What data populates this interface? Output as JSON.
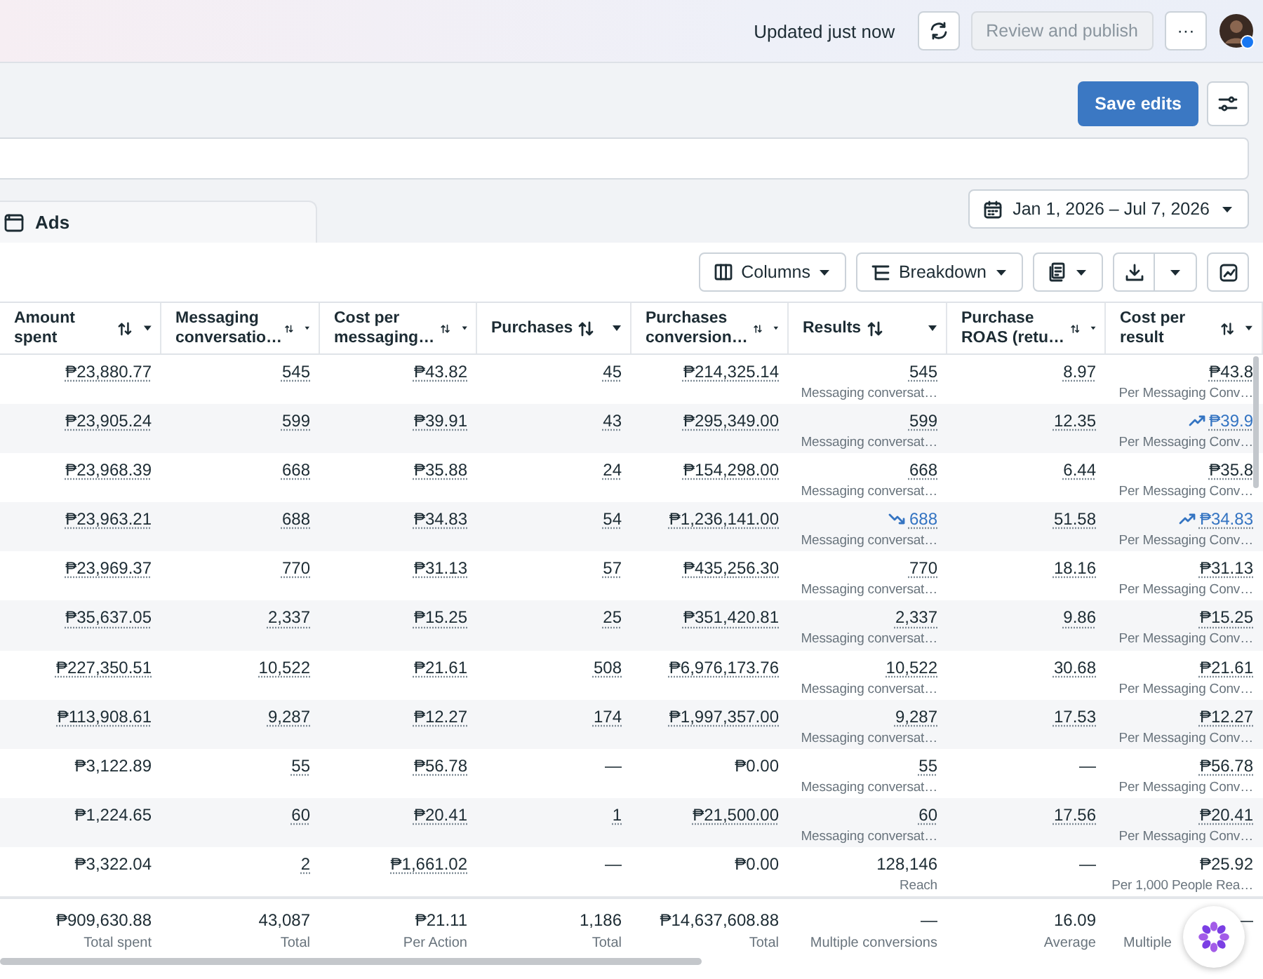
{
  "top_bar": {
    "status": "Updated just now",
    "review_button": {
      "label": "Review and publish",
      "disabled": true
    },
    "more_button": {
      "label": "···"
    }
  },
  "save_button": {
    "label": "Save edits"
  },
  "tab": {
    "label": "Ads"
  },
  "date_range": {
    "label": "Jan 1, 2026 – Jul 7, 2026"
  },
  "toolbar": {
    "columns": "Columns",
    "breakdown": "Breakdown"
  },
  "table": {
    "columns": [
      {
        "label": "Amount spent"
      },
      {
        "label": "Messaging conversatio…"
      },
      {
        "label": "Cost per messaging…"
      },
      {
        "label": "Purchases"
      },
      {
        "label": "Purchases conversion…"
      },
      {
        "label": "Results"
      },
      {
        "label": "Purchase ROAS (retu…"
      },
      {
        "label": "Cost per result"
      }
    ],
    "rows": [
      {
        "cells": [
          {
            "value": "₱23,880.77",
            "underlined": true
          },
          {
            "value": "545",
            "underlined": true
          },
          {
            "value": "₱43.82",
            "underlined": true
          },
          {
            "value": "45",
            "underlined": true
          },
          {
            "value": "₱214,325.14",
            "underlined": true
          },
          {
            "value": "545",
            "underlined": true,
            "sub": "Messaging conversat…"
          },
          {
            "value": "8.97",
            "underlined": true
          },
          {
            "value": "₱43.8",
            "underlined": true,
            "sub": "Per Messaging Conv…"
          }
        ]
      },
      {
        "cells": [
          {
            "value": "₱23,905.24",
            "underlined": true
          },
          {
            "value": "599",
            "underlined": true
          },
          {
            "value": "₱39.91",
            "underlined": true
          },
          {
            "value": "43",
            "underlined": true
          },
          {
            "value": "₱295,349.00",
            "underlined": true
          },
          {
            "value": "599",
            "underlined": true,
            "sub": "Messaging conversat…"
          },
          {
            "value": "12.35",
            "underlined": true
          },
          {
            "value": "₱39.9",
            "underlined": true,
            "trend_up": true,
            "sub": "Per Messaging Conv…"
          }
        ]
      },
      {
        "cells": [
          {
            "value": "₱23,968.39",
            "underlined": true
          },
          {
            "value": "668",
            "underlined": true
          },
          {
            "value": "₱35.88",
            "underlined": true
          },
          {
            "value": "24",
            "underlined": true
          },
          {
            "value": "₱154,298.00",
            "underlined": true
          },
          {
            "value": "668",
            "underlined": true,
            "sub": "Messaging conversat…"
          },
          {
            "value": "6.44",
            "underlined": true
          },
          {
            "value": "₱35.8",
            "underlined": true,
            "sub": "Per Messaging Conv…"
          }
        ]
      },
      {
        "cells": [
          {
            "value": "₱23,963.21",
            "underlined": true
          },
          {
            "value": "688",
            "underlined": true
          },
          {
            "value": "₱34.83",
            "underlined": true
          },
          {
            "value": "54",
            "underlined": true
          },
          {
            "value": "₱1,236,141.00",
            "underlined": true
          },
          {
            "value": "688",
            "underlined": true,
            "trend_down": true,
            "sub": "Messaging conversat…"
          },
          {
            "value": "51.58",
            "underlined": true
          },
          {
            "value": "₱34.83",
            "underlined": true,
            "trend_up": true,
            "sub": "Per Messaging Conv…"
          }
        ]
      },
      {
        "cells": [
          {
            "value": "₱23,969.37",
            "underlined": true
          },
          {
            "value": "770",
            "underlined": true
          },
          {
            "value": "₱31.13",
            "underlined": true
          },
          {
            "value": "57",
            "underlined": true
          },
          {
            "value": "₱435,256.30",
            "underlined": true
          },
          {
            "value": "770",
            "underlined": true,
            "sub": "Messaging conversat…"
          },
          {
            "value": "18.16",
            "underlined": true
          },
          {
            "value": "₱31.13",
            "underlined": true,
            "sub": "Per Messaging Conv…"
          }
        ]
      },
      {
        "cells": [
          {
            "value": "₱35,637.05",
            "underlined": true
          },
          {
            "value": "2,337",
            "underlined": true
          },
          {
            "value": "₱15.25",
            "underlined": true
          },
          {
            "value": "25",
            "underlined": true
          },
          {
            "value": "₱351,420.81",
            "underlined": true
          },
          {
            "value": "2,337",
            "underlined": true,
            "sub": "Messaging conversat…"
          },
          {
            "value": "9.86",
            "underlined": true
          },
          {
            "value": "₱15.25",
            "underlined": true,
            "sub": "Per Messaging Conv…"
          }
        ]
      },
      {
        "cells": [
          {
            "value": "₱227,350.51",
            "underlined": true
          },
          {
            "value": "10,522",
            "underlined": true
          },
          {
            "value": "₱21.61",
            "underlined": true
          },
          {
            "value": "508",
            "underlined": true
          },
          {
            "value": "₱6,976,173.76",
            "underlined": true
          },
          {
            "value": "10,522",
            "underlined": true,
            "sub": "Messaging conversat…"
          },
          {
            "value": "30.68",
            "underlined": true
          },
          {
            "value": "₱21.61",
            "underlined": true,
            "sub": "Per Messaging Conv…"
          }
        ]
      },
      {
        "cells": [
          {
            "value": "₱113,908.61",
            "underlined": true
          },
          {
            "value": "9,287",
            "underlined": true
          },
          {
            "value": "₱12.27",
            "underlined": true
          },
          {
            "value": "174",
            "underlined": true
          },
          {
            "value": "₱1,997,357.00",
            "underlined": true
          },
          {
            "value": "9,287",
            "underlined": true,
            "sub": "Messaging conversat…"
          },
          {
            "value": "17.53",
            "underlined": true
          },
          {
            "value": "₱12.27",
            "underlined": true,
            "sub": "Per Messaging Conv…"
          }
        ]
      },
      {
        "cells": [
          {
            "value": "₱3,122.89",
            "underlined": false
          },
          {
            "value": "55",
            "underlined": true
          },
          {
            "value": "₱56.78",
            "underlined": true
          },
          {
            "value": "—",
            "underlined": false
          },
          {
            "value": "₱0.00",
            "underlined": false
          },
          {
            "value": "55",
            "underlined": true,
            "sub": "Messaging conversat…"
          },
          {
            "value": "—",
            "underlined": false
          },
          {
            "value": "₱56.78",
            "underlined": true,
            "sub": "Per Messaging Conv…"
          }
        ]
      },
      {
        "cells": [
          {
            "value": "₱1,224.65",
            "underlined": false
          },
          {
            "value": "60",
            "underlined": true
          },
          {
            "value": "₱20.41",
            "underlined": true
          },
          {
            "value": "1",
            "underlined": true
          },
          {
            "value": "₱21,500.00",
            "underlined": true
          },
          {
            "value": "60",
            "underlined": true,
            "sub": "Messaging conversat…"
          },
          {
            "value": "17.56",
            "underlined": true
          },
          {
            "value": "₱20.41",
            "underlined": true,
            "sub": "Per Messaging Conv…"
          }
        ]
      },
      {
        "cells": [
          {
            "value": "₱3,322.04",
            "underlined": false
          },
          {
            "value": "2",
            "underlined": true
          },
          {
            "value": "₱1,661.02",
            "underlined": true
          },
          {
            "value": "—",
            "underlined": false
          },
          {
            "value": "₱0.00",
            "underlined": false
          },
          {
            "value": "128,146",
            "underlined": false,
            "sub": "Reach"
          },
          {
            "value": "—",
            "underlined": false
          },
          {
            "value": "₱25.92",
            "underlined": false,
            "sub": "Per 1,000 People Rea…"
          }
        ]
      }
    ],
    "totals": [
      {
        "value": "₱909,630.88",
        "sub": "Total spent"
      },
      {
        "value": "43,087",
        "sub": "Total"
      },
      {
        "value": "₱21.11",
        "sub": "Per Action"
      },
      {
        "value": "1,186",
        "sub": "Total"
      },
      {
        "value": "₱14,637,608.88",
        "sub": "Total"
      },
      {
        "value": "—",
        "sub": "Multiple conversions"
      },
      {
        "value": "16.09",
        "sub": "Average"
      },
      {
        "value": "—",
        "sub": "Multiple"
      }
    ]
  }
}
